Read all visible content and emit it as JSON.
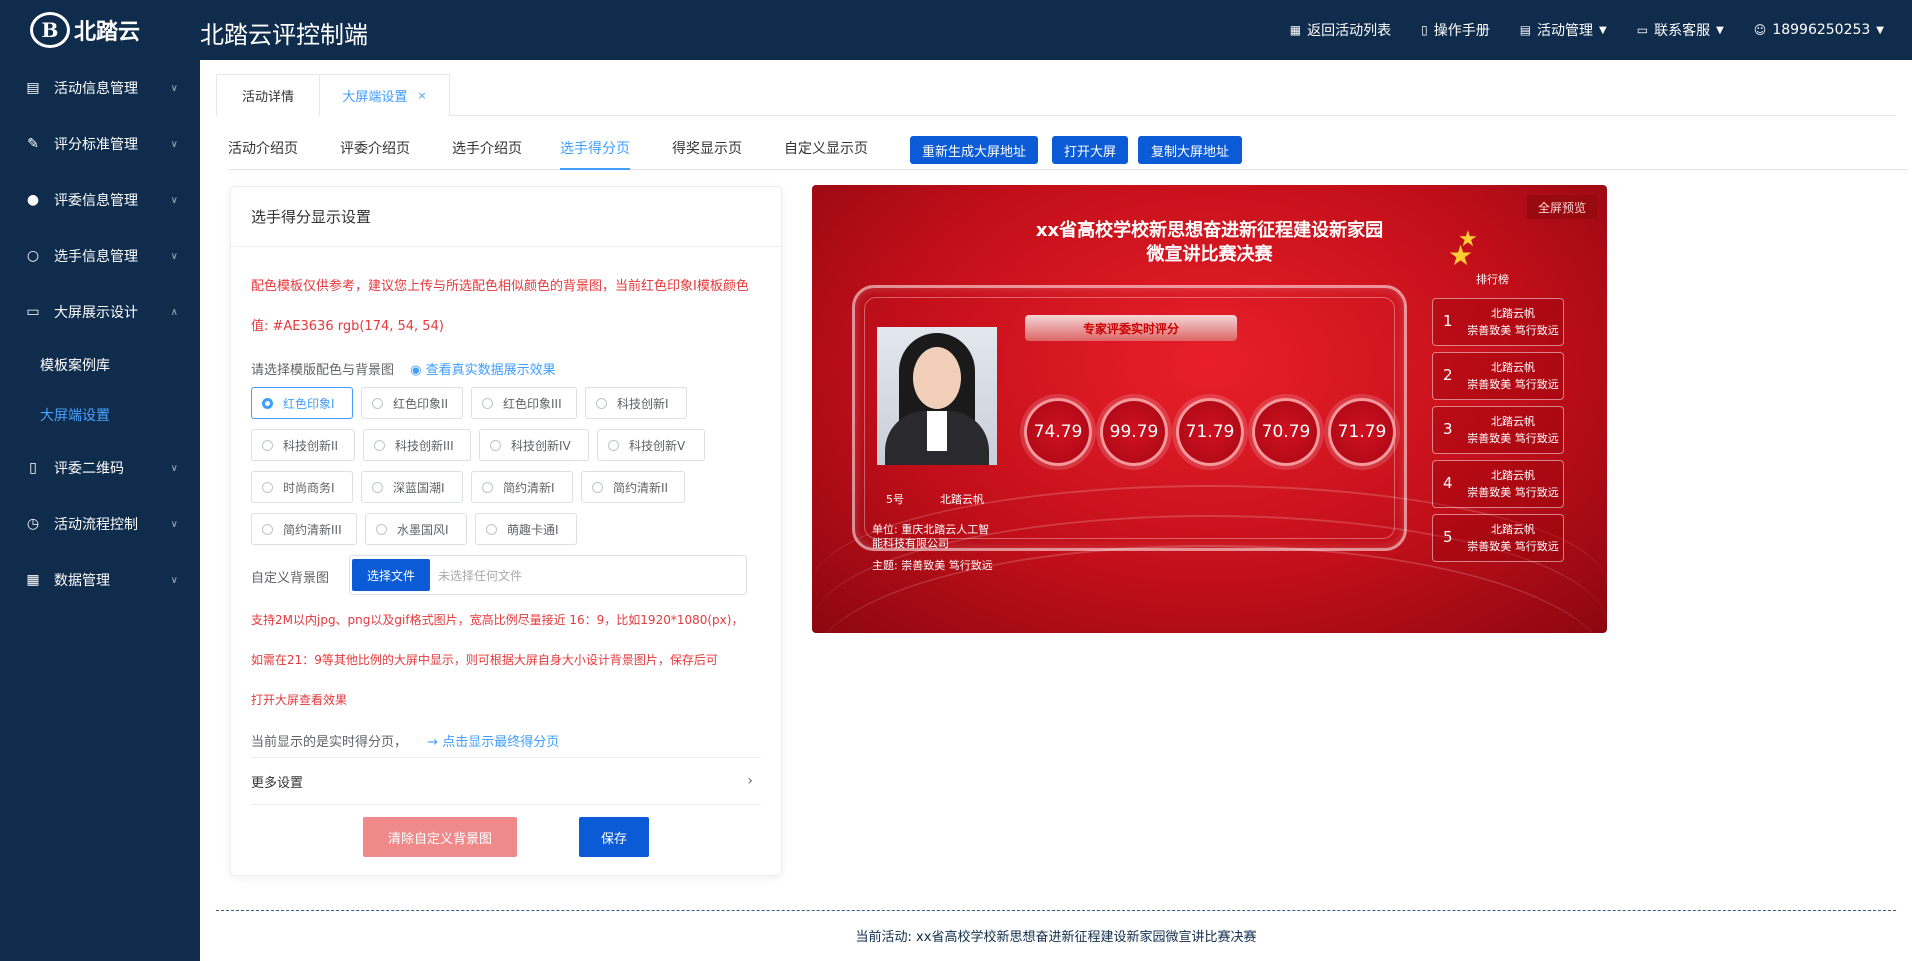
{
  "header": {
    "logo_mark": "B",
    "logo_text": "北踏云",
    "app_title": "北踏云评控制端",
    "nav": {
      "back_list": "返回活动列表",
      "manual": "操作手册",
      "activity_mgmt": "活动管理",
      "support": "联系客服",
      "user": "18996250253"
    }
  },
  "sidebar": {
    "items": [
      {
        "label": "活动信息管理",
        "icon": "document-icon"
      },
      {
        "label": "评分标准管理",
        "icon": "edit-icon"
      },
      {
        "label": "评委信息管理",
        "icon": "user-filled-icon"
      },
      {
        "label": "选手信息管理",
        "icon": "user-icon"
      },
      {
        "label": "大屏展示设计",
        "icon": "monitor-icon"
      },
      {
        "label": "评委二维码",
        "icon": "phone-icon"
      },
      {
        "label": "活动流程控制",
        "icon": "alarm-icon"
      },
      {
        "label": "数据管理",
        "icon": "calendar-icon"
      }
    ],
    "subitems": [
      "模板案例库",
      "大屏端设置"
    ]
  },
  "tabs": {
    "t1": "活动详情",
    "t2": "大屏端设置",
    "close": "×"
  },
  "subnav": {
    "items": [
      "活动介绍页",
      "评委介绍页",
      "选手介绍页",
      "选手得分页",
      "得奖显示页",
      "自定义显示页"
    ],
    "btn_regen": "重新生成大屏地址",
    "btn_open": "打开大屏",
    "btn_copy": "复制大屏地址"
  },
  "panel": {
    "title": "选手得分显示设置",
    "note1": "配色模板仅供参考，建议您上传与所选配色相似颜色的背景图，当前红色印象I模板颜色",
    "note2": "值:  #AE3636   rgb(174, 54, 54)",
    "choose_label": "请选择模版配色与背景图",
    "view_real": "查看真实数据展示效果",
    "templates": [
      [
        "红色印象I",
        "红色印象II",
        "红色印象III",
        "科技创新I"
      ],
      [
        "科技创新II",
        "科技创新III",
        "科技创新IV",
        "科技创新V"
      ],
      [
        "时尚商务I",
        "深蓝国潮I",
        "简约清新I",
        "简约清新II"
      ],
      [
        "简约清新III",
        "水墨国风I",
        "萌趣卡通I"
      ]
    ],
    "custom_bg_label": "自定义背景图",
    "file_btn": "选择文件",
    "file_placeholder": "未选择任何文件",
    "support1": "支持2M以内jpg、png以及gif格式图片，宽高比例尽量接近 16：9，比如1920*1080(px)，",
    "support2": "如需在21：9等其他比例的大屏中显示，则可根据大屏自身大小设计背景图片，保存后可",
    "support3": "打开大屏查看效果",
    "current_text": "当前显示的是实时得分页，",
    "current_link": "点击显示最终得分页",
    "more": "更多设置",
    "clear_btn": "清除自定义背景图",
    "save_btn": "保存"
  },
  "preview": {
    "fullscreen": "全屏预览",
    "title1": "xx省高校学校新思想奋进新征程建设新家园",
    "title2": "微宣讲比赛决赛",
    "badge": "专家评委实时评分",
    "contestant_no": "5号",
    "contestant_name": "北踏云帆",
    "unit1": "单位:  重庆北踏云人工智",
    "unit2": "能科技有限公司",
    "theme": "主题:  崇善致美 笃行致远",
    "scores": [
      "74.79",
      "99.79",
      "71.79",
      "70.79",
      "71.79"
    ],
    "rank_title": "排行榜",
    "ranking": [
      {
        "num": "1",
        "name": "北踏云帆",
        "slogan": "崇善致美 笃行致远"
      },
      {
        "num": "2",
        "name": "北踏云帆",
        "slogan": "崇善致美 笃行致远"
      },
      {
        "num": "3",
        "name": "北踏云帆",
        "slogan": "崇善致美 笃行致远"
      },
      {
        "num": "4",
        "name": "北踏云帆",
        "slogan": "崇善致美 笃行致远"
      },
      {
        "num": "5",
        "name": "北踏云帆",
        "slogan": "崇善致美 笃行致远"
      }
    ]
  },
  "footer": {
    "current_activity": "当前活动:  xx省高校学校新思想奋进新征程建设新家园微宣讲比赛决赛"
  }
}
